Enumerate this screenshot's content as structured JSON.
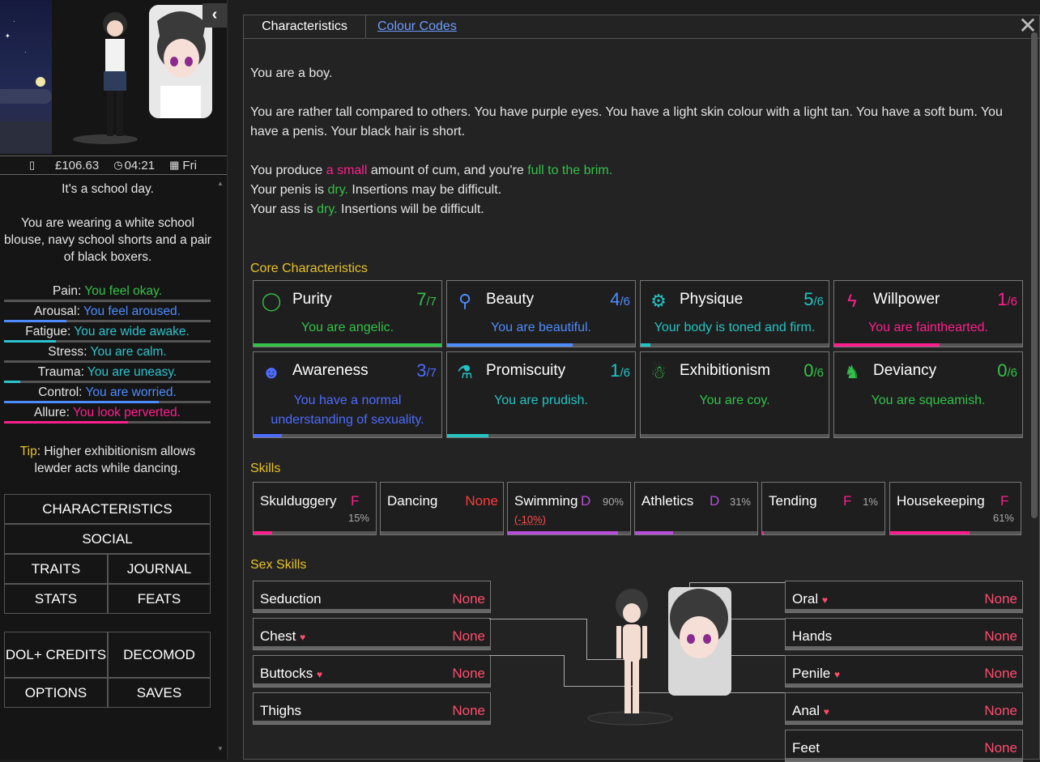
{
  "sidebar": {
    "money": "£106.63",
    "time": "04:21",
    "day": "Fri",
    "day_message": "It's a school day.",
    "clothing_text": "You are wearing a white school blouse, navy school shorts and a pair of black boxers.",
    "meters": [
      {
        "label": "Pain",
        "status": "You feel okay.",
        "color": "#33c24a",
        "fill": 0
      },
      {
        "label": "Arousal",
        "status": "You feel aroused.",
        "color": "#4d8cff",
        "fill": 0.3
      },
      {
        "label": "Fatigue",
        "status": "You are wide awake.",
        "color": "#2bc4cf",
        "fill": 0.25
      },
      {
        "label": "Stress",
        "status": "You are calm.",
        "color": "#2bc4cf",
        "fill": 0
      },
      {
        "label": "Trauma",
        "status": "You are uneasy.",
        "color": "#2bc4cf",
        "fill": 0.08
      },
      {
        "label": "Control",
        "status": "You are worried.",
        "color": "#4d8cff",
        "fill": 0.75
      },
      {
        "label": "Allure",
        "status": "You look perverted.",
        "color": "#ff1f8e",
        "fill": 0.6
      }
    ],
    "tip_label": "Tip",
    "tip_text": ": Higher exhibitionism allows lewder acts while dancing.",
    "menu": {
      "characteristics": "CHARACTERISTICS",
      "social": "SOCIAL",
      "traits": "TRAITS",
      "journal": "JOURNAL",
      "stats": "STATS",
      "feats": "FEATS",
      "dol_credits": "DOL+ CREDITS",
      "decomod": "DECOMOD",
      "options": "OPTIONS",
      "saves": "SAVES"
    }
  },
  "tabs": {
    "active": "Characteristics",
    "colour_codes": "Colour Codes"
  },
  "intro": {
    "gender": "You are a boy.",
    "body": "You are rather tall compared to others. You have purple eyes. You have a light skin colour with a light tan. You have a soft bum. You have a penis. Your black hair is short.",
    "cum_1": "You produce ",
    "cum_amount": "a small",
    "cum_2": " amount of cum, and you're ",
    "cum_full": "full to the brim.",
    "penis_1": "Your penis is ",
    "penis_dry": "dry.",
    "penis_2": " Insertions may be difficult.",
    "ass_1": "Your ass is ",
    "ass_dry": "dry.",
    "ass_2": " Insertions will be difficult."
  },
  "core_title": "Core Characteristics",
  "core": [
    {
      "name": "Purity",
      "value": "7",
      "max": "/7",
      "desc": "You are angelic.",
      "color": "#33c24a",
      "fill": 1.0,
      "icon": "halo-icon"
    },
    {
      "name": "Beauty",
      "value": "4",
      "max": "/6",
      "desc": "You are beautiful.",
      "color": "#4d8cff",
      "fill": 0.67,
      "icon": "mirror-icon"
    },
    {
      "name": "Physique",
      "value": "5",
      "max": "/6",
      "desc": "Your body is toned and firm.",
      "color": "#24c3c3",
      "fill": 0.05,
      "icon": "dumbbell-icon"
    },
    {
      "name": "Willpower",
      "value": "1",
      "max": "/6",
      "desc": "You are fainthearted.",
      "color": "#ff1f8e",
      "fill": 0.56,
      "icon": "lightning-icon"
    },
    {
      "name": "Awareness",
      "value": "3",
      "max": "/7",
      "desc": "You have a normal understanding of sexuality.",
      "color": "#4d6cff",
      "fill": 0.15,
      "icon": "face-icon"
    },
    {
      "name": "Promiscuity",
      "value": "1",
      "max": "/6",
      "desc": "You are prudish.",
      "color": "#24c3c3",
      "fill": 0.22,
      "icon": "potion-icon"
    },
    {
      "name": "Exhibitionism",
      "value": "0",
      "max": "/6",
      "desc": "You are coy.",
      "color": "#33c24a",
      "fill": 0,
      "icon": "figure-icon"
    },
    {
      "name": "Deviancy",
      "value": "0",
      "max": "/6",
      "desc": "You are squeamish.",
      "color": "#33c24a",
      "fill": 0,
      "icon": "creature-icon"
    }
  ],
  "skills_title": "Skills",
  "skills": [
    {
      "name": "Skulduggery",
      "grade": "F",
      "pct": "15%",
      "grade_color": "#ff1f8e",
      "fill": 0.15,
      "bar_color": "#ff1f8e"
    },
    {
      "name": "Dancing",
      "grade": "None",
      "pct": "",
      "grade_color": "#ff3b3b",
      "fill": 0,
      "bar_color": "#ff1f8e"
    },
    {
      "name": "Swimming",
      "grade": "D",
      "pct": "90%",
      "extra": "(-10%)",
      "grade_color": "#b84dd9",
      "fill": 0.9,
      "bar_color": "#b84dd9"
    },
    {
      "name": "Athletics",
      "grade": "D",
      "pct": "31%",
      "grade_color": "#b84dd9",
      "fill": 0.31,
      "bar_color": "#b84dd9"
    },
    {
      "name": "Tending",
      "grade": "F",
      "pct": "1%",
      "grade_color": "#ff1f8e",
      "fill": 0.01,
      "bar_color": "#ff1f8e"
    },
    {
      "name": "Housekeeping",
      "grade": "F",
      "pct": "61%",
      "grade_color": "#ff1f8e",
      "fill": 0.61,
      "bar_color": "#ff1f8e"
    }
  ],
  "sex_title": "Sex Skills",
  "sex_left": [
    {
      "name": "Seduction",
      "heart": "",
      "val": "None"
    },
    {
      "name": "Chest",
      "heart": "♥",
      "val": "None"
    },
    {
      "name": "Buttocks",
      "heart": "♥",
      "val": "None"
    },
    {
      "name": "Thighs",
      "heart": "",
      "val": "None"
    }
  ],
  "sex_right": [
    {
      "name": "Oral",
      "heart": "♥",
      "val": "None"
    },
    {
      "name": "Hands",
      "heart": "",
      "val": "None"
    },
    {
      "name": "Penile",
      "heart": "♥",
      "val": "None"
    },
    {
      "name": "Anal",
      "heart": "♥",
      "val": "None"
    },
    {
      "name": "Feet",
      "heart": "",
      "val": "None"
    }
  ]
}
